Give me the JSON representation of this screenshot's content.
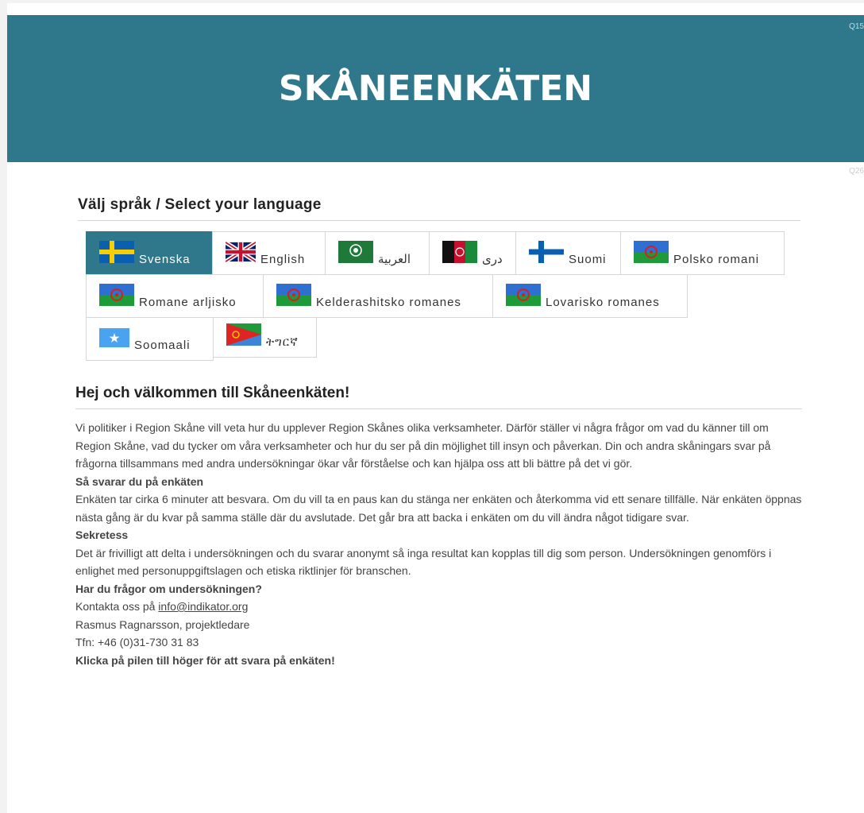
{
  "header": {
    "title": "SKÅNEENKÄTEN",
    "q1": "Q15",
    "q2": "Q26"
  },
  "language": {
    "heading": "Välj språk / Select your language",
    "tabs": [
      {
        "label": "Svenska",
        "flag": "sweden-flag-icon"
      },
      {
        "label": "English",
        "flag": "uk-flag-icon"
      },
      {
        "label": "العربية",
        "flag": "arab-league-flag-icon"
      },
      {
        "label": "دری",
        "flag": "afghanistan-flag-icon"
      },
      {
        "label": "Suomi",
        "flag": "finland-flag-icon"
      },
      {
        "label": "Polsko romani",
        "flag": "romani-flag-icon"
      },
      {
        "label": "Romane arljisko",
        "flag": "romani-flag-icon"
      },
      {
        "label": "Kelderashitsko romanes",
        "flag": "romani-flag-icon"
      },
      {
        "label": "Lovarisko romanes",
        "flag": "romani-flag-icon"
      },
      {
        "label": "Soomaali",
        "flag": "somalia-flag-icon"
      },
      {
        "label": "ትግርኛ",
        "flag": "eritrea-flag-icon"
      }
    ],
    "active_index": 0
  },
  "welcome": {
    "title": "Hej och välkommen till Skåneenkäten!",
    "intro": "Vi politiker i Region Skåne vill veta hur du upplever Region Skånes olika verksamheter. Därför ställer vi några frågor om vad du känner till om Region Skåne, vad du tycker om våra verksamheter och hur du ser på din möjlighet till insyn och påverkan. Din och andra skåningars svar på frågorna tillsammans med andra undersökningar ökar vår förståelse och kan hjälpa oss att bli bättre på det vi gör.",
    "how_title": "Så svarar du på enkäten",
    "how_text": "Enkäten tar cirka 6 minuter att besvara. Om du vill ta en paus kan du stänga ner enkäten och återkomma vid ett senare tillfälle. När enkäten öppnas nästa gång är du kvar på samma ställe där du avslutade. Det går bra att backa i enkäten om du vill ändra något tidigare svar.",
    "privacy_title": "Sekretess",
    "privacy_text": "Det är frivilligt att delta i undersökningen och du svarar anonymt så inga resultat kan kopplas till dig som person. Undersökningen genomförs i enlighet med personuppgiftslagen och etiska riktlinjer för branschen.",
    "questions_title": "Har du frågor om undersökningen?",
    "contact_prefix": "Kontakta oss på ",
    "contact_email": "info@indikator.org",
    "contact_person": "Rasmus Ragnarsson, projektledare",
    "contact_phone": "Tfn: +46 (0)31-730 31 83",
    "cta": "Klicka på pilen till höger för att svara på enkäten!"
  },
  "colors": {
    "accent": "#2f788c",
    "background": "#f2f2f2"
  }
}
